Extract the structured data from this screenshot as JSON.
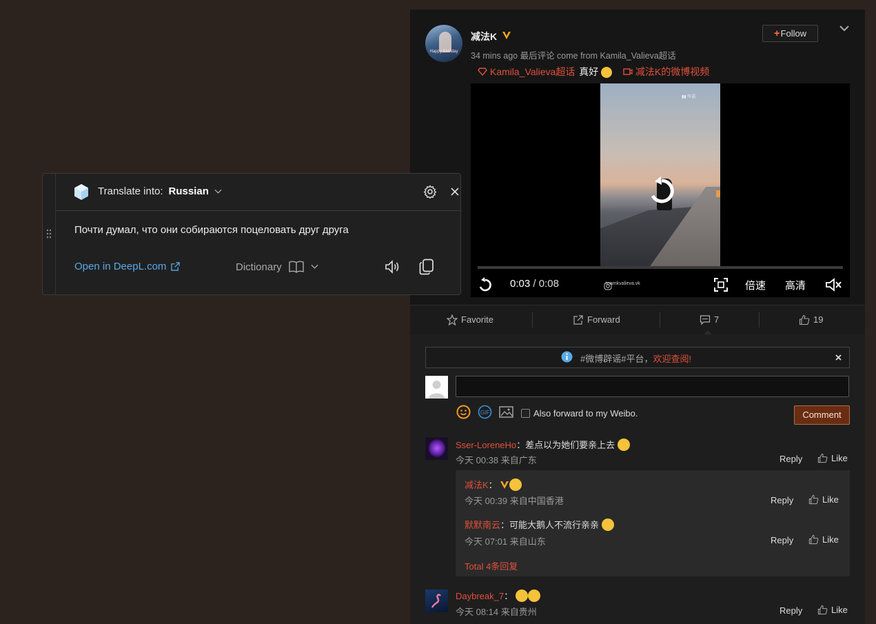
{
  "weibo": {
    "post": {
      "username": "减法K",
      "meta": "34 mins ago 最后评论 come from Kamila_Valieva超话",
      "follow_label": "Follow",
      "tag_topic": "Kamila_Valieva超话",
      "tag_text": "真好",
      "tag_video": "减法K的微博视频",
      "video": {
        "current_time": "0:03",
        "separator": " / ",
        "total_time": "0:08",
        "speed_label": "倍速",
        "quality_label": "高清",
        "watermark": "toamkvalieva.vk",
        "progress": 0.0
      }
    },
    "actions": {
      "favorite": "Favorite",
      "forward": "Forward",
      "comments_count": "7",
      "likes_count": "19"
    },
    "notice": {
      "prefix": "#微博辟谣#平台，",
      "highlight": "欢迎查阅!"
    },
    "composer": {
      "forward_label": "Also forward to my Weibo.",
      "comment_button": "Comment"
    },
    "comments": [
      {
        "name": "Sser-LoreneHo",
        "sep": "：",
        "text": "差点以为她们要亲上去",
        "time": "今天 00:38 来自广东",
        "reply": "Reply",
        "like": "Like"
      },
      {
        "name": "Daybreak_7",
        "sep": "：",
        "text": "",
        "time": "今天 08:14 来自贵州",
        "reply": "Reply",
        "like": "Like"
      }
    ],
    "replies": [
      {
        "name": "减法K",
        "sep": "：",
        "text": "",
        "time": "今天 00:39 来自中国香港",
        "reply": "Reply",
        "like": "Like"
      },
      {
        "name": "默默南云",
        "sep": "：",
        "text": "可能大鹅人不流行亲亲",
        "time": "今天 07:01 来自山东",
        "reply": "Reply",
        "like": "Like"
      }
    ],
    "total_replies": "Total 4条回复"
  },
  "deepl": {
    "translate_into_label": "Translate into:",
    "language": "Russian",
    "translation": "Почти думал, что они собираются поцеловать друг друга",
    "open_link": "Open in DeepL.com",
    "dictionary_label": "Dictionary"
  },
  "colors": {
    "accent_red": "#e0503d",
    "deepl_link": "#5aa9e6",
    "comment_button_bg": "#6a2d12",
    "page_bg": "#2c231e"
  }
}
